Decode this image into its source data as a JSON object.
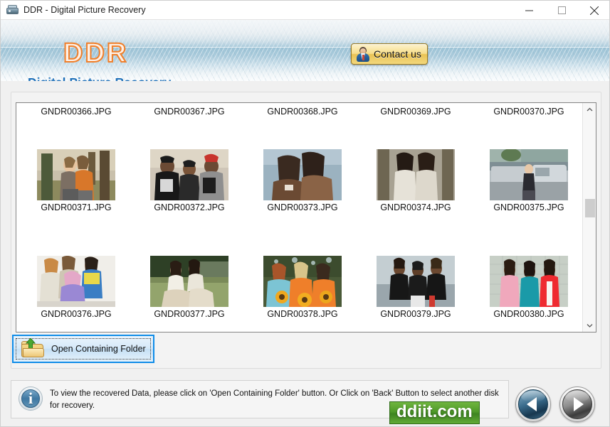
{
  "window": {
    "title": "DDR - Digital Picture Recovery",
    "app_icon": "scanner-icon",
    "minimize_label": "Minimize",
    "maximize_label": "Maximize",
    "close_label": "Close"
  },
  "header": {
    "logo": "DDR",
    "subtitle": "Digital Picture Recovery",
    "contact_button": {
      "label": "Contact us",
      "icon": "user-icon"
    }
  },
  "file_list": {
    "rows": [
      {
        "labels_top": [
          "GNDR00366.JPG",
          "GNDR00367.JPG",
          "GNDR00368.JPG",
          "GNDR00369.JPG",
          "GNDR00370.JPG"
        ],
        "items": [
          {
            "name": "GNDR00371.JPG",
            "thumb": "two-women-hugging-autumn"
          },
          {
            "name": "GNDR00372.JPG",
            "thumb": "three-men-street-style"
          },
          {
            "name": "GNDR00373.JPG",
            "thumb": "two-women-brown-coats"
          },
          {
            "name": "GNDR00374.JPG",
            "thumb": "two-women-white-dresses"
          },
          {
            "name": "GNDR00375.JPG",
            "thumb": "woman-beside-car"
          }
        ]
      },
      {
        "items": [
          {
            "name": "GNDR00376.JPG",
            "thumb": "four-friends-colorful"
          },
          {
            "name": "GNDR00377.JPG",
            "thumb": "two-women-park-bench"
          },
          {
            "name": "GNDR00378.JPG",
            "thumb": "three-women-sunflowers"
          },
          {
            "name": "GNDR00379.JPG",
            "thumb": "three-men-black-shirts"
          },
          {
            "name": "GNDR00380.JPG",
            "thumb": "three-women-teal-red"
          }
        ]
      }
    ],
    "scrollbar": {
      "up_icon": "chevron-up-icon",
      "down_icon": "chevron-down-icon",
      "thumb_position_percent": 45
    }
  },
  "actions": {
    "open_folder": {
      "label": "Open Containing Folder",
      "icon": "folder-up-icon",
      "focused": true
    }
  },
  "status": {
    "icon": "info-icon",
    "message": "To view the recovered Data, please click on 'Open Containing Folder' button. Or Click on 'Back' Button to select another disk for recovery."
  },
  "watermark": {
    "text": "ddiit.com"
  },
  "navigation": {
    "back": {
      "label": "Back",
      "icon": "triangle-left-icon"
    },
    "next": {
      "label": "Next",
      "icon": "triangle-right-icon"
    }
  },
  "colors": {
    "accent_blue": "#1d6fb8",
    "logo_orange": "#f07f2a",
    "focus_blue": "#0f8ce8",
    "watermark_green": "#4f9a29",
    "button_gold": "#e8c254"
  }
}
